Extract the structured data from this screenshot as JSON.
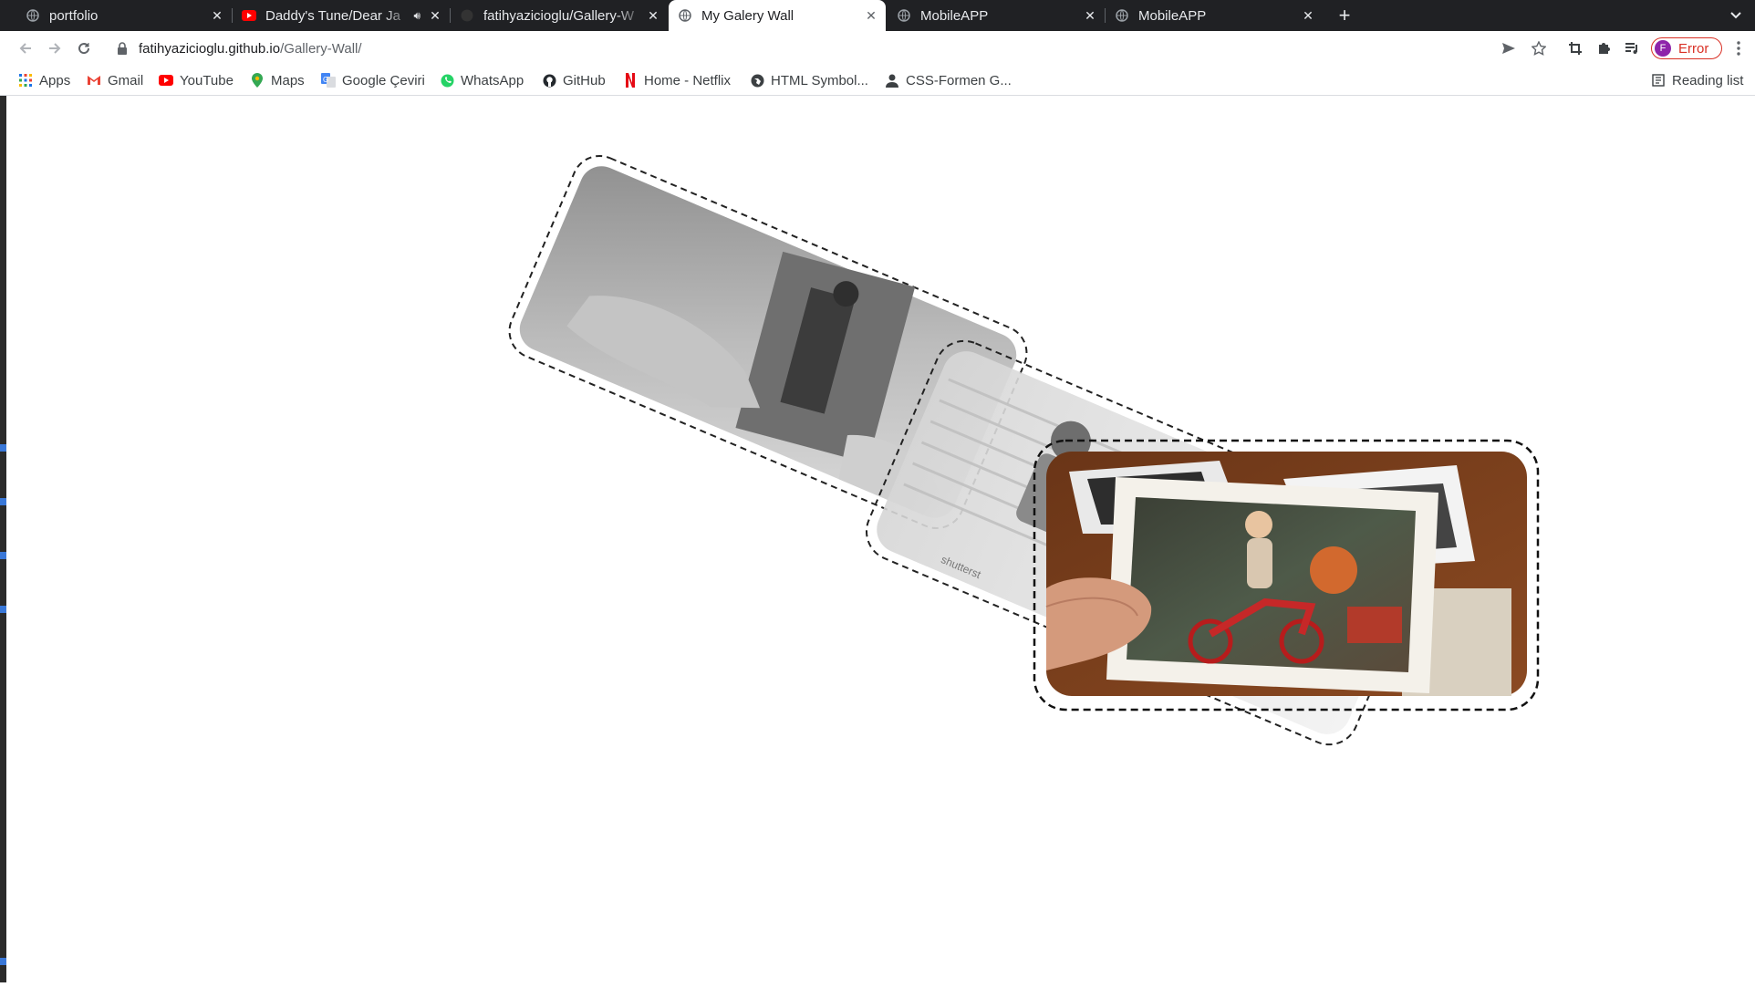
{
  "tabs": [
    {
      "title": "portfolio",
      "icon": "globe-icon"
    },
    {
      "title": "Daddy's Tune/Dear Ja",
      "icon": "youtube-icon",
      "audio": true
    },
    {
      "title": "fatihyazicioglu/Gallery-W",
      "icon": "github-icon"
    },
    {
      "title": "My Galery Wall",
      "icon": "globe-icon",
      "active": true
    },
    {
      "title": "MobileAPP",
      "icon": "globe-icon"
    },
    {
      "title": "MobileAPP",
      "icon": "globe-icon"
    }
  ],
  "address": {
    "host": "fatihyazicioglu.github.io",
    "path": "/Gallery-Wall/"
  },
  "profile": {
    "initial": "F",
    "status": "Error"
  },
  "bookmarks": [
    {
      "label": "Apps",
      "icon": "apps-grid-icon"
    },
    {
      "label": "Gmail",
      "icon": "gmail-icon"
    },
    {
      "label": "YouTube",
      "icon": "youtube-icon"
    },
    {
      "label": "Maps",
      "icon": "maps-pin-icon"
    },
    {
      "label": "Google Çeviri",
      "icon": "translate-icon"
    },
    {
      "label": "WhatsApp",
      "icon": "whatsapp-icon"
    },
    {
      "label": "GitHub",
      "icon": "github-icon"
    },
    {
      "label": "Home - Netflix",
      "icon": "netflix-icon"
    },
    {
      "label": "HTML Symbol...",
      "icon": "globe-icon"
    },
    {
      "label": "CSS-Formen G...",
      "icon": "person-icon"
    }
  ],
  "reading_list": "Reading list",
  "gallery": {
    "photos": [
      {
        "name": "photo-old-hand",
        "description_icon": "photo-icon"
      },
      {
        "name": "photo-stairs",
        "watermark": "shutterst"
      },
      {
        "name": "photo-boy-tricycle"
      }
    ]
  },
  "colors": {
    "tabstrip": "#202124",
    "error": "#d93025",
    "avatar": "#8e24aa"
  }
}
